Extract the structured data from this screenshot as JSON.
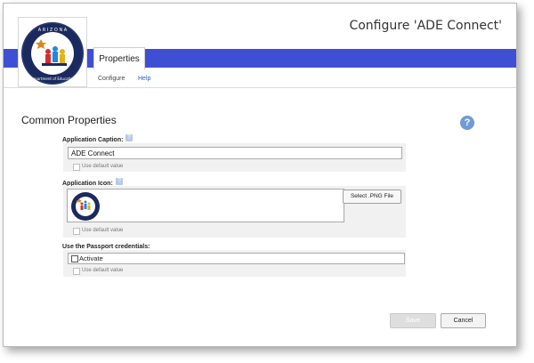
{
  "header": {
    "title": "Configure 'ADE Connect'",
    "logo": {
      "icon": "arizona-department-of-education-seal",
      "top_text": "ARIZONA",
      "bottom_text": "Department of Education"
    }
  },
  "nav": {
    "active_tab": "Properties",
    "subnav": [
      "Configure",
      "Help"
    ]
  },
  "section": {
    "title": "Common Properties",
    "help_icon": "?"
  },
  "fields": {
    "caption": {
      "label": "Application Caption:",
      "value": "ADE Connect",
      "default_label": "Use default value"
    },
    "icon": {
      "label": "Application Icon:",
      "button_label": "Select .PNG File",
      "default_label": "Use default value"
    },
    "passport": {
      "label": "Use the Passport credentials:",
      "activate_label": "Activate",
      "default_label": "Use default value"
    }
  },
  "actions": {
    "save": "Save",
    "cancel": "Cancel"
  },
  "colors": {
    "nav_bar": "#3f4fd3",
    "help_icon": "#6f9bd6",
    "link": "#1f5fc4"
  }
}
